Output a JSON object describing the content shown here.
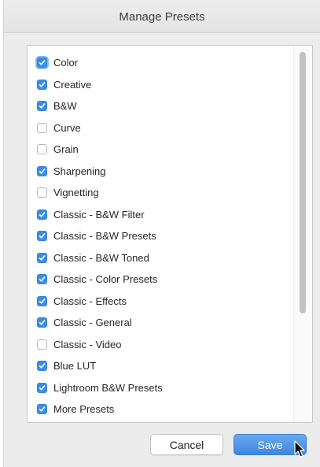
{
  "window": {
    "title": "Manage Presets"
  },
  "presets": [
    {
      "label": "Color",
      "checked": true
    },
    {
      "label": "Creative",
      "checked": true
    },
    {
      "label": "B&W",
      "checked": true
    },
    {
      "label": "Curve",
      "checked": false
    },
    {
      "label": "Grain",
      "checked": false
    },
    {
      "label": "Sharpening",
      "checked": true
    },
    {
      "label": "Vignetting",
      "checked": false
    },
    {
      "label": "Classic - B&W Filter",
      "checked": true
    },
    {
      "label": "Classic - B&W Presets",
      "checked": true
    },
    {
      "label": "Classic - B&W Toned",
      "checked": true
    },
    {
      "label": "Classic - Color Presets",
      "checked": true
    },
    {
      "label": "Classic - Effects",
      "checked": true
    },
    {
      "label": "Classic - General",
      "checked": true
    },
    {
      "label": "Classic - Video",
      "checked": false
    },
    {
      "label": "Blue LUT",
      "checked": true
    },
    {
      "label": "Lightroom B&W Presets",
      "checked": true
    },
    {
      "label": "More Presets",
      "checked": true
    }
  ],
  "buttons": {
    "cancel_label": "Cancel",
    "save_label": "Save"
  },
  "colors": {
    "accent": "#3b8ee8",
    "dialog_background": "#ececec"
  }
}
